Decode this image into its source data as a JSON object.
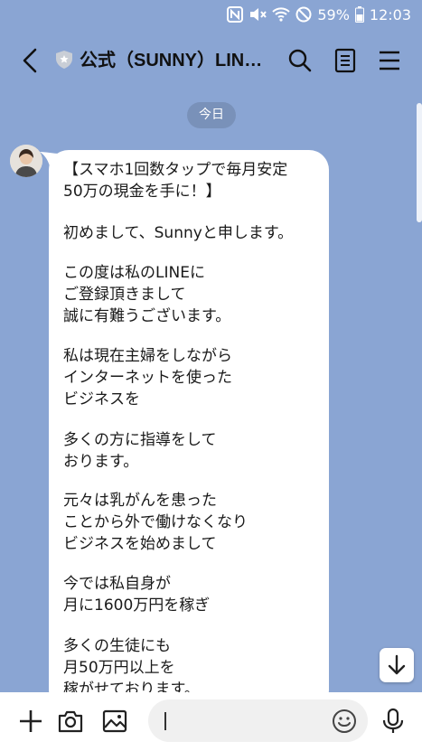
{
  "status_bar": {
    "battery": "59%",
    "time": "12:03"
  },
  "header": {
    "title": "公式（SUNNY）LINE…"
  },
  "chat": {
    "date_label": "今日",
    "message_lines": [
      "【スマホ1回数タップで毎月安定",
      "50万の現金を手に！】",
      "",
      "初めまして、Sunnyと申します。",
      "",
      "この度は私のLINEに",
      "ご登録頂きまして",
      "誠に有難うございます。",
      "",
      "私は現在主婦をしながら",
      "インターネットを使った",
      "ビジネスを",
      "",
      "多くの方に指導をして",
      "おります。",
      "",
      "元々は乳がんを患った",
      "ことから外で働けなくなり",
      "ビジネスを始めまして",
      "",
      "今では私自身が",
      "月に1600万円を稼ぎ",
      "",
      "多くの生徒にも",
      "月50万円以上を",
      "稼がせております。"
    ]
  },
  "icons": {
    "back": "chevron-left-icon",
    "verified": "shield-star-icon",
    "search": "search-icon",
    "notes": "notes-icon",
    "menu": "menu-icon",
    "scroll_down": "arrow-down-icon",
    "add": "plus-icon",
    "camera": "camera-icon",
    "image": "image-icon",
    "emoji": "emoji-icon",
    "mic": "microphone-icon"
  },
  "colors": {
    "chat_background": "#8aa5d3",
    "bubble": "#ffffff",
    "bottom_bar": "#ffffff"
  }
}
